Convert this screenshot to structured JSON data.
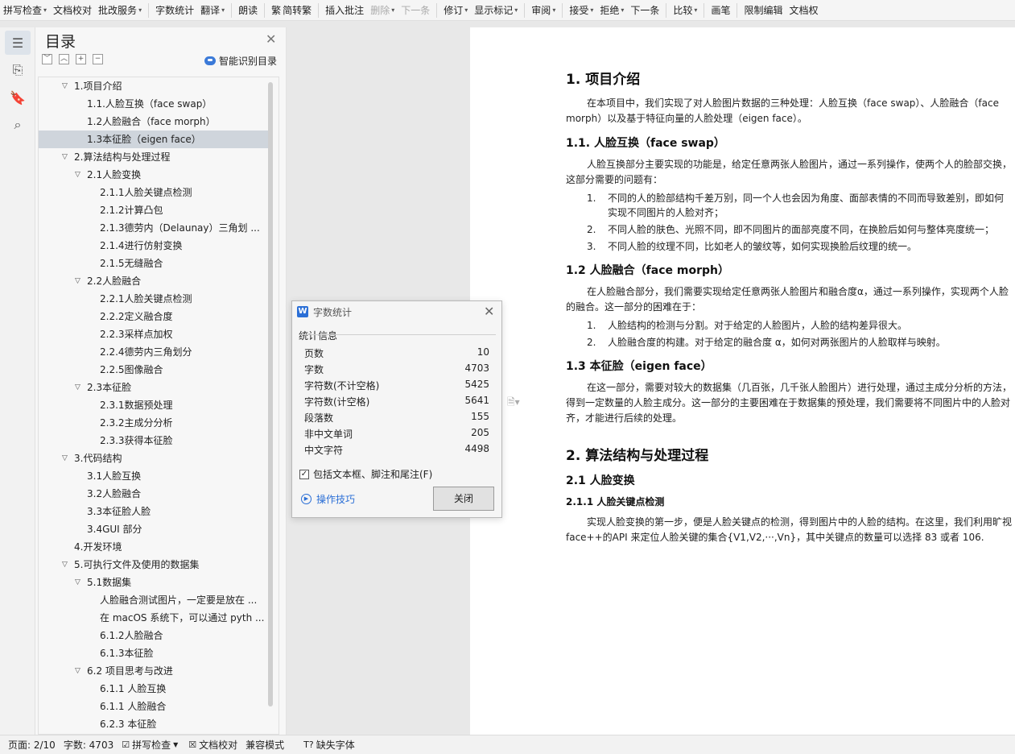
{
  "toolbar": {
    "items": [
      {
        "label": "拼写检查",
        "caret": true
      },
      {
        "label": "文档校对"
      },
      {
        "label": "批改服务",
        "caret": true
      },
      {
        "label": "字数统计"
      },
      {
        "label": "翻译",
        "caret": true
      },
      {
        "label": "朗读"
      },
      {
        "label": "简转繁",
        "icon": "繁"
      },
      {
        "label": "插入批注"
      },
      {
        "label": "删除",
        "caret": true,
        "disabled": true
      },
      {
        "label": "下一条",
        "disabled": true
      },
      {
        "label": "修订",
        "caret": true
      },
      {
        "label": "显示标记",
        "caret": true
      },
      {
        "label": "审阅",
        "caret": true
      },
      {
        "label": "接受",
        "caret": true
      },
      {
        "label": "拒绝",
        "caret": true
      },
      {
        "label": "下一条"
      },
      {
        "label": "比较",
        "caret": true
      },
      {
        "label": "画笔"
      },
      {
        "label": "限制编辑"
      },
      {
        "label": "文档权"
      }
    ]
  },
  "toc": {
    "title": "目录",
    "smart_label": "智能识别目录",
    "items": [
      {
        "text": "1.项目介绍",
        "level": 1,
        "arrow": true
      },
      {
        "text": "1.1.人脸互换（face swap）",
        "level": 2
      },
      {
        "text": "1.2人脸融合（face morph）",
        "level": 2
      },
      {
        "text": "1.3本征脸（eigen face）",
        "level": 2,
        "selected": true
      },
      {
        "text": "2.算法结构与处理过程",
        "level": 1,
        "arrow": true
      },
      {
        "text": "2.1人脸变换",
        "level": 2,
        "arrow": true
      },
      {
        "text": "2.1.1人脸关键点检测",
        "level": 3
      },
      {
        "text": "2.1.2计算凸包",
        "level": 3
      },
      {
        "text": "2.1.3德劳内（Delaunay）三角划 ...",
        "level": 3
      },
      {
        "text": "2.1.4进行仿射变换",
        "level": 3
      },
      {
        "text": "2.1.5无缝融合",
        "level": 3
      },
      {
        "text": "2.2人脸融合",
        "level": 2,
        "arrow": true
      },
      {
        "text": "2.2.1人脸关键点检测",
        "level": 3
      },
      {
        "text": "2.2.2定义融合度",
        "level": 3
      },
      {
        "text": "2.2.3采样点加权",
        "level": 3
      },
      {
        "text": "2.2.4德劳内三角划分",
        "level": 3
      },
      {
        "text": "2.2.5图像融合",
        "level": 3
      },
      {
        "text": "2.3本征脸",
        "level": 2,
        "arrow": true
      },
      {
        "text": "2.3.1数据预处理",
        "level": 3
      },
      {
        "text": "2.3.2主成分分析",
        "level": 3
      },
      {
        "text": "2.3.3获得本征脸",
        "level": 3
      },
      {
        "text": "3.代码结构",
        "level": 1,
        "arrow": true
      },
      {
        "text": "3.1人脸互换",
        "level": 2
      },
      {
        "text": "3.2人脸融合",
        "level": 2
      },
      {
        "text": "3.3本征脸人脸",
        "level": 2
      },
      {
        "text": "3.4GUI 部分",
        "level": 2
      },
      {
        "text": "4.开发环境",
        "level": 1
      },
      {
        "text": "5.可执行文件及使用的数据集",
        "level": 1,
        "arrow": true
      },
      {
        "text": "5.1数据集",
        "level": 2,
        "arrow": true
      },
      {
        "text": "人脸融合测试图片，一定要是放在 ...",
        "level": 3
      },
      {
        "text": "在 macOS 系统下，可以通过 pyth ...",
        "level": 3
      },
      {
        "text": "6.1.2人脸融合",
        "level": 3
      },
      {
        "text": "6.1.3本征脸",
        "level": 3
      },
      {
        "text": "6.2 项目思考与改进",
        "level": 2,
        "arrow": true
      },
      {
        "text": "6.1.1 人脸互换",
        "level": 3
      },
      {
        "text": "6.1.1 人脸融合",
        "level": 3
      },
      {
        "text": "6.2.3 本征脸",
        "level": 3
      }
    ]
  },
  "dialog": {
    "title": "字数统计",
    "section": "统计信息",
    "stats": [
      {
        "label": "页数",
        "value": "10"
      },
      {
        "label": "字数",
        "value": "4703"
      },
      {
        "label": "字符数(不计空格)",
        "value": "5425"
      },
      {
        "label": "字符数(计空格)",
        "value": "5641"
      },
      {
        "label": "段落数",
        "value": "155"
      },
      {
        "label": "非中文单词",
        "value": "205"
      },
      {
        "label": "中文字符",
        "value": "4498"
      }
    ],
    "include_label": "包括文本框、脚注和尾注(F)",
    "include_checked": true,
    "tips_label": "操作技巧",
    "close_label": "关闭"
  },
  "doc": {
    "h_1": "1.  项目介绍",
    "p_1": "在本项目中，我们实现了对人脸图片数据的三种处理：人脸互换（face swap）、人脸融合（face morph）以及基于特征向量的人脸处理（eigen face）。",
    "h_11": "1.1.  人脸互换（face swap）",
    "p_11": "人脸互换部分主要实现的功能是，给定任意两张人脸图片，通过一系列操作，使两个人的脸部交换，这部分需要的问题有：",
    "list_11": [
      {
        "n": "1.",
        "t": "不同的人的脸部结构千差万别，同一个人也会因为角度、面部表情的不同而导致差别，即如何实现不同图片的人脸对齐；"
      },
      {
        "n": "2.",
        "t": "不同人脸的肤色、光照不同，即不同图片的面部亮度不同，在换脸后如何与整体亮度统一；"
      },
      {
        "n": "3.",
        "t": "不同人脸的纹理不同，比如老人的皱纹等，如何实现换脸后纹理的统一。"
      }
    ],
    "h_12": "1.2 人脸融合（face morph）",
    "p_12": "在人脸融合部分，我们需要实现给定任意两张人脸图片和融合度α，通过一系列操作，实现两个人脸的融合。这一部分的困难在于：",
    "list_12": [
      {
        "n": "1.",
        "t": "人脸结构的检测与分割。对于给定的人脸图片，人脸的结构差异很大。"
      },
      {
        "n": "2.",
        "t": "人脸融合度的构建。对于给定的融合度 α，如何对两张图片的人脸取样与映射。"
      }
    ],
    "h_13": "1.3 本征脸（eigen face）",
    "p_13": "在这一部分，需要对较大的数据集（几百张，几千张人脸图片）进行处理，通过主成分分析的方法，得到一定数量的人脸主成分。这一部分的主要困难在于数据集的预处理，我们需要将不同图片中的人脸对齐，才能进行后续的处理。",
    "h_2": "2.  算法结构与处理过程",
    "h_21": "2.1 人脸变换",
    "h_211": "2.1.1 人脸关键点检测",
    "p_211": "实现人脸变换的第一步，便是人脸关键点的检测，得到图片中的人脸的结构。在这里，我们利用旷视face++的API 来定位人脸关键的集合{V1,V2,···,Vn}，其中关键点的数量可以选择 83 或者 106."
  },
  "status": {
    "page": "页面: 2/10",
    "words": "字数: 4703",
    "spell": "拼写检查",
    "proof": "文档校对",
    "compat": "兼容模式",
    "font": "缺失字体"
  }
}
